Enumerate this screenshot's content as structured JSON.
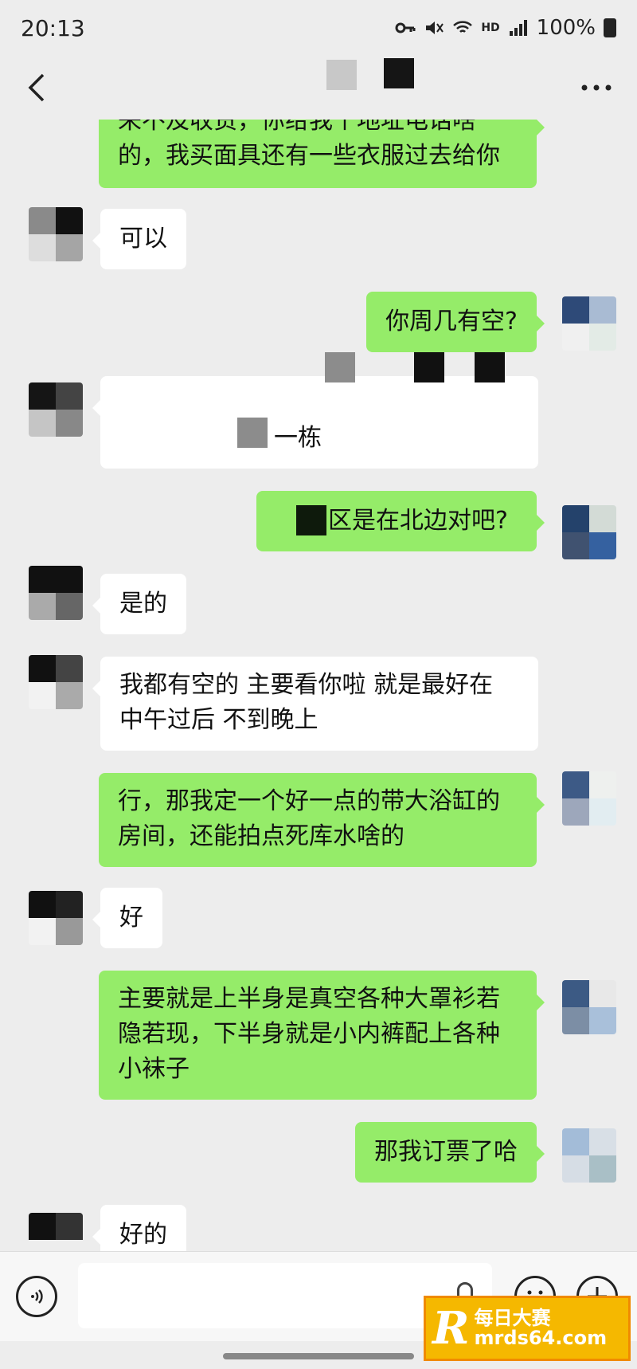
{
  "status": {
    "time": "20:13",
    "network_label": "HD",
    "battery": "100%"
  },
  "nav": {
    "back_icon": "chevron-left-icon",
    "more_icon": "more-dots-icon"
  },
  "messages": [
    {
      "side": "right",
      "text_lines": [
        "来不及收货，你给我个地址电话啥",
        "的，我买面具还有一些衣服过去给你"
      ]
    },
    {
      "side": "left",
      "text_lines": [
        "可以"
      ]
    },
    {
      "side": "right",
      "text_lines": [
        "你周几有空?"
      ]
    },
    {
      "side": "left",
      "text_lines": [
        "",
        "一栋"
      ]
    },
    {
      "side": "right",
      "text_lines": [
        "区是在北边对吧?"
      ]
    },
    {
      "side": "left",
      "text_lines": [
        "是的"
      ]
    },
    {
      "side": "left",
      "text_lines": [
        "我都有空的 主要看你啦 就是最好在",
        "中午过后 不到晚上"
      ]
    },
    {
      "side": "right",
      "text_lines": [
        "行，那我定一个好一点的带大浴缸的",
        "房间，还能拍点死库水啥的"
      ]
    },
    {
      "side": "left",
      "text_lines": [
        "好"
      ]
    },
    {
      "side": "right",
      "text_lines": [
        "主要就是上半身是真空各种大罩衫若",
        "隐若现，下半身就是小内裤配上各种",
        "小袜子"
      ]
    },
    {
      "side": "right",
      "text_lines": [
        "那我订票了哈"
      ]
    },
    {
      "side": "left",
      "text_lines": [
        "好的"
      ]
    }
  ],
  "input": {
    "placeholder": ""
  },
  "watermark": {
    "logo": "R",
    "line1": "每日大赛",
    "line2": "mrds64.com"
  },
  "colors": {
    "background": "#ededed",
    "sent_bubble": "#95ec69",
    "received_bubble": "#ffffff"
  }
}
